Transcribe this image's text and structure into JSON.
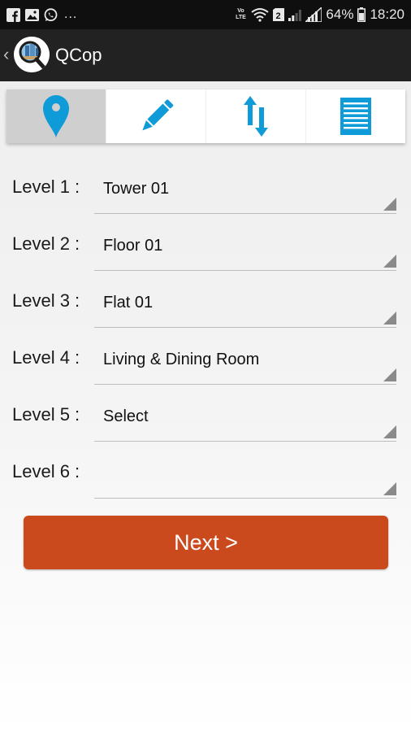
{
  "status_bar": {
    "notification_icons": [
      "facebook-icon",
      "gallery-icon",
      "whatsapp-icon"
    ],
    "more_indicator": "...",
    "network_label": "Vo LTE",
    "battery": "64%",
    "time": "18:20"
  },
  "app_bar": {
    "title": "QCop",
    "back_glyph": "‹"
  },
  "tabs": [
    {
      "icon": "location-pin-icon",
      "active": true
    },
    {
      "icon": "pencil-icon",
      "active": false
    },
    {
      "icon": "sort-arrows-icon",
      "active": false
    },
    {
      "icon": "list-icon",
      "active": false
    }
  ],
  "levels": [
    {
      "label": "Level 1 :",
      "value": "Tower 01"
    },
    {
      "label": "Level 2 :",
      "value": "Floor 01"
    },
    {
      "label": "Level 3 :",
      "value": "Flat 01"
    },
    {
      "label": "Level 4 :",
      "value": "Living & Dining Room"
    },
    {
      "label": "Level 5 :",
      "value": "Select"
    },
    {
      "label": "Level 6 :",
      "value": ""
    }
  ],
  "next_button": {
    "label": "Next >"
  },
  "colors": {
    "accent_blue": "#0e9bd8",
    "next_button": "#cb4a1d",
    "app_bar": "#222222",
    "status_bar": "#0f0f0f"
  }
}
